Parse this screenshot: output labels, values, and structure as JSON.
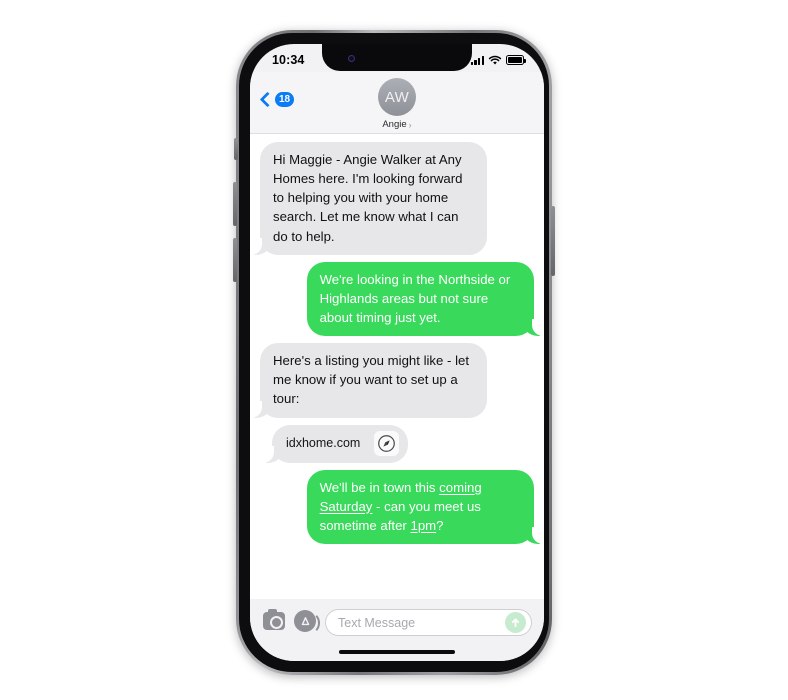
{
  "status_bar": {
    "time": "10:34",
    "cellular_icon": "cellular-signal-icon",
    "wifi_icon": "wifi-icon",
    "battery_icon": "battery-full-icon"
  },
  "nav": {
    "back_icon": "back-chevron-icon",
    "unread_badge": "18",
    "avatar_initials": "AW",
    "contact_name": "Angie",
    "contact_chevron": "›"
  },
  "messages": [
    {
      "id": "msg-1",
      "side": "incoming",
      "text": "Hi Maggie - Angie Walker at Any Homes here. I'm looking forward to helping you with your home search. Let me know what I can do to help."
    },
    {
      "id": "msg-2",
      "side": "outgoing",
      "text": "We're looking in the Northside or Highlands areas but not sure about timing just yet."
    },
    {
      "id": "msg-3",
      "side": "incoming",
      "text": "Here's a listing you might like - let me know if you want to set up a tour:"
    },
    {
      "id": "msg-4",
      "side": "incoming",
      "type": "link",
      "link_text": "idxhome.com",
      "link_icon": "safari-compass-icon"
    },
    {
      "id": "msg-5",
      "side": "outgoing",
      "type": "rich",
      "segments": [
        {
          "text": "We'll be in town this ",
          "underline": false
        },
        {
          "text": "coming Saturday",
          "underline": true
        },
        {
          "text": " - can you meet us sometime after ",
          "underline": false
        },
        {
          "text": "1pm",
          "underline": true
        },
        {
          "text": "?",
          "underline": false
        }
      ]
    }
  ],
  "input_bar": {
    "camera_icon": "camera-icon",
    "appstore_icon": "app-store-icon",
    "placeholder": "Text Message",
    "send_icon": "send-arrow-icon"
  },
  "colors": {
    "outgoing_bubble": "#39d95c",
    "incoming_bubble": "#e7e7e9",
    "accent_blue": "#0a7cf6",
    "send_button": "#c6ebcf"
  }
}
